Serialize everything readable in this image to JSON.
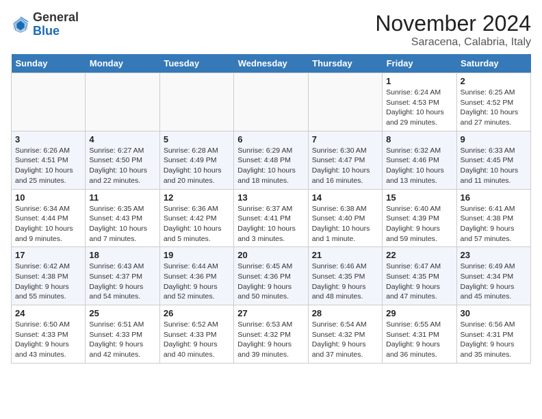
{
  "header": {
    "logo_general": "General",
    "logo_blue": "Blue",
    "month_title": "November 2024",
    "subtitle": "Saracena, Calabria, Italy"
  },
  "weekdays": [
    "Sunday",
    "Monday",
    "Tuesday",
    "Wednesday",
    "Thursday",
    "Friday",
    "Saturday"
  ],
  "weeks": [
    [
      {
        "day": "",
        "info": ""
      },
      {
        "day": "",
        "info": ""
      },
      {
        "day": "",
        "info": ""
      },
      {
        "day": "",
        "info": ""
      },
      {
        "day": "",
        "info": ""
      },
      {
        "day": "1",
        "info": "Sunrise: 6:24 AM\nSunset: 4:53 PM\nDaylight: 10 hours and 29 minutes."
      },
      {
        "day": "2",
        "info": "Sunrise: 6:25 AM\nSunset: 4:52 PM\nDaylight: 10 hours and 27 minutes."
      }
    ],
    [
      {
        "day": "3",
        "info": "Sunrise: 6:26 AM\nSunset: 4:51 PM\nDaylight: 10 hours and 25 minutes."
      },
      {
        "day": "4",
        "info": "Sunrise: 6:27 AM\nSunset: 4:50 PM\nDaylight: 10 hours and 22 minutes."
      },
      {
        "day": "5",
        "info": "Sunrise: 6:28 AM\nSunset: 4:49 PM\nDaylight: 10 hours and 20 minutes."
      },
      {
        "day": "6",
        "info": "Sunrise: 6:29 AM\nSunset: 4:48 PM\nDaylight: 10 hours and 18 minutes."
      },
      {
        "day": "7",
        "info": "Sunrise: 6:30 AM\nSunset: 4:47 PM\nDaylight: 10 hours and 16 minutes."
      },
      {
        "day": "8",
        "info": "Sunrise: 6:32 AM\nSunset: 4:46 PM\nDaylight: 10 hours and 13 minutes."
      },
      {
        "day": "9",
        "info": "Sunrise: 6:33 AM\nSunset: 4:45 PM\nDaylight: 10 hours and 11 minutes."
      }
    ],
    [
      {
        "day": "10",
        "info": "Sunrise: 6:34 AM\nSunset: 4:44 PM\nDaylight: 10 hours and 9 minutes."
      },
      {
        "day": "11",
        "info": "Sunrise: 6:35 AM\nSunset: 4:43 PM\nDaylight: 10 hours and 7 minutes."
      },
      {
        "day": "12",
        "info": "Sunrise: 6:36 AM\nSunset: 4:42 PM\nDaylight: 10 hours and 5 minutes."
      },
      {
        "day": "13",
        "info": "Sunrise: 6:37 AM\nSunset: 4:41 PM\nDaylight: 10 hours and 3 minutes."
      },
      {
        "day": "14",
        "info": "Sunrise: 6:38 AM\nSunset: 4:40 PM\nDaylight: 10 hours and 1 minute."
      },
      {
        "day": "15",
        "info": "Sunrise: 6:40 AM\nSunset: 4:39 PM\nDaylight: 9 hours and 59 minutes."
      },
      {
        "day": "16",
        "info": "Sunrise: 6:41 AM\nSunset: 4:38 PM\nDaylight: 9 hours and 57 minutes."
      }
    ],
    [
      {
        "day": "17",
        "info": "Sunrise: 6:42 AM\nSunset: 4:38 PM\nDaylight: 9 hours and 55 minutes."
      },
      {
        "day": "18",
        "info": "Sunrise: 6:43 AM\nSunset: 4:37 PM\nDaylight: 9 hours and 54 minutes."
      },
      {
        "day": "19",
        "info": "Sunrise: 6:44 AM\nSunset: 4:36 PM\nDaylight: 9 hours and 52 minutes."
      },
      {
        "day": "20",
        "info": "Sunrise: 6:45 AM\nSunset: 4:36 PM\nDaylight: 9 hours and 50 minutes."
      },
      {
        "day": "21",
        "info": "Sunrise: 6:46 AM\nSunset: 4:35 PM\nDaylight: 9 hours and 48 minutes."
      },
      {
        "day": "22",
        "info": "Sunrise: 6:47 AM\nSunset: 4:35 PM\nDaylight: 9 hours and 47 minutes."
      },
      {
        "day": "23",
        "info": "Sunrise: 6:49 AM\nSunset: 4:34 PM\nDaylight: 9 hours and 45 minutes."
      }
    ],
    [
      {
        "day": "24",
        "info": "Sunrise: 6:50 AM\nSunset: 4:33 PM\nDaylight: 9 hours and 43 minutes."
      },
      {
        "day": "25",
        "info": "Sunrise: 6:51 AM\nSunset: 4:33 PM\nDaylight: 9 hours and 42 minutes."
      },
      {
        "day": "26",
        "info": "Sunrise: 6:52 AM\nSunset: 4:33 PM\nDaylight: 9 hours and 40 minutes."
      },
      {
        "day": "27",
        "info": "Sunrise: 6:53 AM\nSunset: 4:32 PM\nDaylight: 9 hours and 39 minutes."
      },
      {
        "day": "28",
        "info": "Sunrise: 6:54 AM\nSunset: 4:32 PM\nDaylight: 9 hours and 37 minutes."
      },
      {
        "day": "29",
        "info": "Sunrise: 6:55 AM\nSunset: 4:31 PM\nDaylight: 9 hours and 36 minutes."
      },
      {
        "day": "30",
        "info": "Sunrise: 6:56 AM\nSunset: 4:31 PM\nDaylight: 9 hours and 35 minutes."
      }
    ]
  ]
}
